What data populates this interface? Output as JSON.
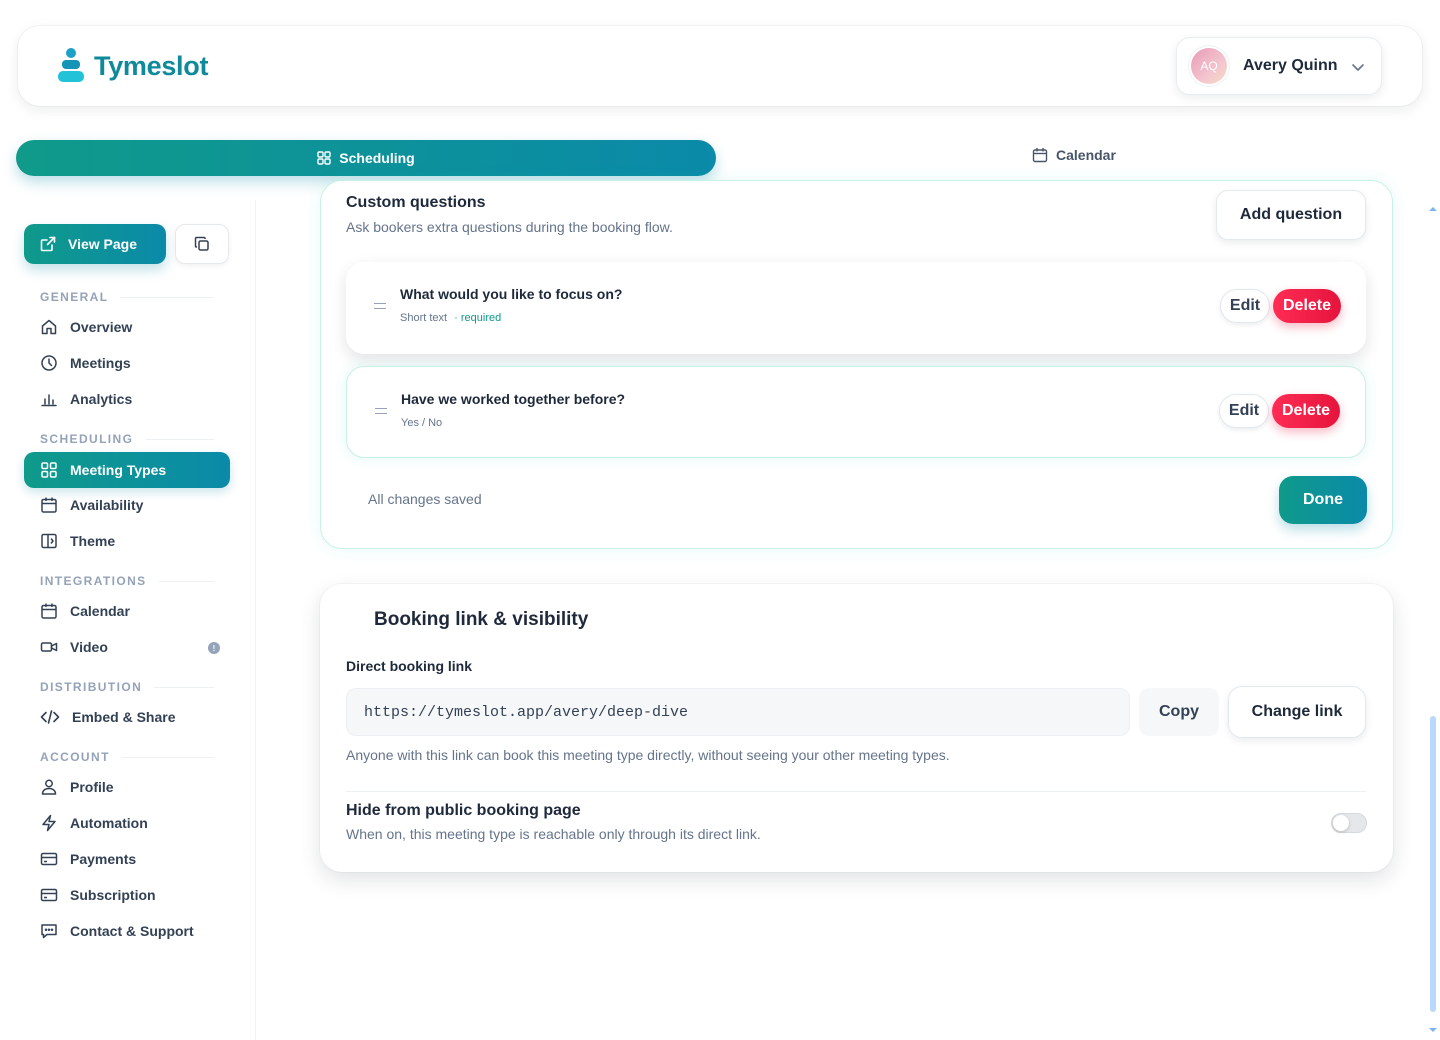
{
  "header": {
    "app_name": "Tymeslot",
    "user": {
      "initials": "AQ",
      "name": "Avery Quinn"
    }
  },
  "tabs": [
    {
      "label": "Scheduling",
      "active": true
    },
    {
      "label": "Calendar",
      "active": false
    }
  ],
  "sidebar": {
    "view_page_label": "View Page",
    "sections": [
      {
        "label": "GENERAL",
        "items": [
          {
            "label": "Overview",
            "icon": "home-icon"
          },
          {
            "label": "Meetings",
            "icon": "clock-icon"
          },
          {
            "label": "Analytics",
            "icon": "bar-chart-icon"
          }
        ]
      },
      {
        "label": "SCHEDULING",
        "items": [
          {
            "label": "Meeting Types",
            "icon": "grid-icon",
            "active": true
          },
          {
            "label": "Availability",
            "icon": "calendar-icon"
          },
          {
            "label": "Theme",
            "icon": "layout-icon"
          }
        ]
      },
      {
        "label": "INTEGRATIONS",
        "items": [
          {
            "label": "Calendar",
            "icon": "calendar-icon"
          },
          {
            "label": "Video",
            "icon": "video-icon",
            "badge": "!"
          }
        ]
      },
      {
        "label": "DISTRIBUTION",
        "items": [
          {
            "label": "Embed & Share",
            "icon": "code-icon"
          }
        ]
      },
      {
        "label": "ACCOUNT",
        "items": [
          {
            "label": "Profile",
            "icon": "user-icon"
          },
          {
            "label": "Automation",
            "icon": "bolt-icon"
          },
          {
            "label": "Payments",
            "icon": "credit-card-icon"
          },
          {
            "label": "Subscription",
            "icon": "credit-card-icon"
          },
          {
            "label": "Contact & Support",
            "icon": "chat-icon"
          }
        ]
      }
    ]
  },
  "custom_questions": {
    "title": "Custom questions",
    "subtitle": "Ask bookers extra questions during the booking flow.",
    "add_label": "Add question",
    "questions": [
      {
        "label": "What would you like to focus on?",
        "type": "Short text",
        "required": "· required"
      },
      {
        "label": "Have we worked together before?",
        "type": "Yes / No",
        "required": ""
      }
    ],
    "edit_label": "Edit",
    "delete_label": "Delete",
    "status": "All changes saved",
    "done_label": "Done"
  },
  "booking_link": {
    "title": "Booking link & visibility",
    "direct_label": "Direct booking link",
    "url": "https://tymeslot.app/avery/deep-dive",
    "copy_label": "Copy",
    "change_label": "Change link",
    "help": "Anyone with this link can book this meeting type directly, without seeing your other meeting types.",
    "hide_title": "Hide from public booking page",
    "hide_subtitle": "When on, this meeting type is reachable only through its direct link.",
    "hide_enabled": false
  },
  "colors": {
    "brand": "#0f9a8a",
    "brand_alt": "#0b8aa9",
    "danger": "#ff2d55"
  }
}
